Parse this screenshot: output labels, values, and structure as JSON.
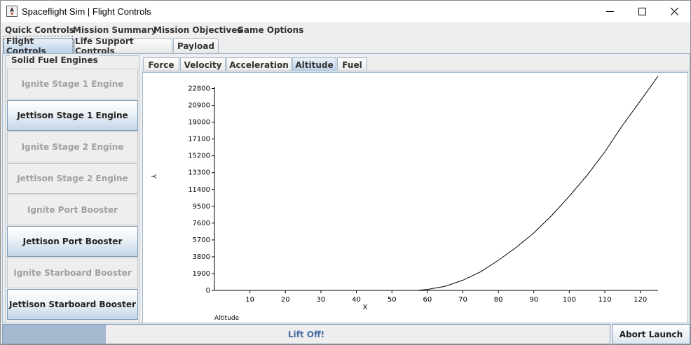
{
  "window": {
    "title": "Spaceflight Sim | Flight Controls",
    "icons": [
      "app-icon",
      "minimize-icon",
      "maximize-icon",
      "close-icon"
    ]
  },
  "menu": [
    "Quick Controls",
    "Mission Summary",
    "Mission Objectives",
    "Game Options"
  ],
  "top_tabs": [
    {
      "label": "Flight Controls",
      "selected": true
    },
    {
      "label": "Life Support Controls",
      "selected": false
    },
    {
      "label": "Payload",
      "selected": false
    }
  ],
  "engines": {
    "title": "Solid Fuel Engines",
    "buttons": [
      {
        "label": "Ignite Stage 1 Engine",
        "enabled": false
      },
      {
        "label": "Jettison Stage 1 Engine",
        "enabled": true
      },
      {
        "label": "Ignite Stage 2 Engine",
        "enabled": false
      },
      {
        "label": "Jettison Stage 2 Engine",
        "enabled": false
      },
      {
        "label": "Ignite Port Booster",
        "enabled": false
      },
      {
        "label": "Jettison Port Booster",
        "enabled": true
      },
      {
        "label": "Ignite Starboard Booster",
        "enabled": false
      },
      {
        "label": "Jettison Starboard Booster",
        "enabled": true
      }
    ]
  },
  "graph_tabs": [
    {
      "label": "Force",
      "selected": false
    },
    {
      "label": "Velocity",
      "selected": false
    },
    {
      "label": "Acceleration",
      "selected": false
    },
    {
      "label": "Altitude",
      "selected": true
    },
    {
      "label": "Fuel",
      "selected": false
    }
  ],
  "chart_data": {
    "type": "line",
    "title": "Altitude",
    "xlabel": "X",
    "ylabel": "Y",
    "xlim": [
      0,
      125
    ],
    "ylim": [
      0,
      23000
    ],
    "x_ticks": [
      10,
      20,
      30,
      40,
      50,
      60,
      70,
      80,
      90,
      100,
      110,
      120
    ],
    "y_ticks": [
      0,
      1900,
      3800,
      5700,
      7600,
      9500,
      11400,
      13300,
      15200,
      17100,
      19000,
      20900,
      22800
    ],
    "grid": false,
    "series": [
      {
        "x": [
          0,
          10,
          20,
          30,
          40,
          50,
          55,
          57,
          60,
          65,
          70,
          75,
          80,
          85,
          90,
          95,
          100,
          105,
          110,
          115,
          120,
          125
        ],
        "y": [
          0,
          0,
          0,
          0,
          0,
          0,
          0,
          0,
          110,
          470,
          1150,
          2100,
          3400,
          4850,
          6500,
          8450,
          10650,
          13000,
          15650,
          18650,
          21400,
          24600
        ]
      }
    ]
  },
  "status": {
    "progress_text": "Lift Off!",
    "progress_fraction": 0.17,
    "abort_label": "Abort Launch"
  }
}
